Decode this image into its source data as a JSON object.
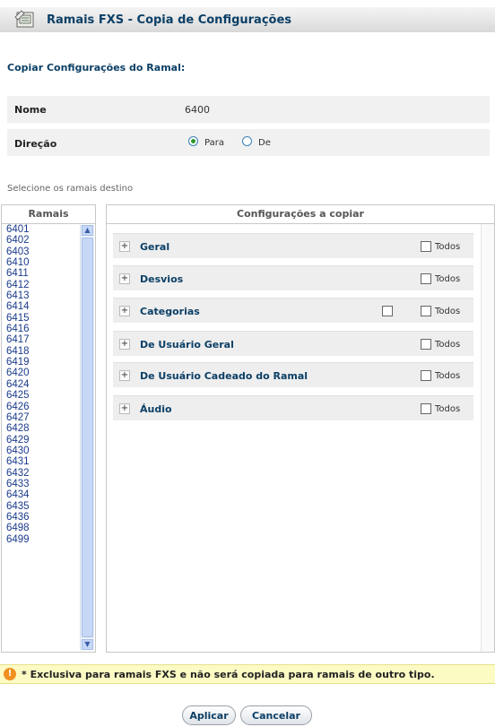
{
  "header": {
    "title": "Ramais FXS - Copia de Configurações",
    "icon": "phone-book-icon"
  },
  "section_title": "Copiar Configurações do Ramal:",
  "form": {
    "nome_label": "Nome",
    "nome_value": "6400",
    "direcao_label": "Direção",
    "radio_para": "Para",
    "radio_de": "De",
    "selected": "Para"
  },
  "hint": "Selecione os ramais destino",
  "ramais": {
    "header": "Ramais",
    "items": [
      "6401",
      "6402",
      "6403",
      "6410",
      "6411",
      "6412",
      "6413",
      "6414",
      "6415",
      "6416",
      "6417",
      "6418",
      "6419",
      "6420",
      "6424",
      "6425",
      "6426",
      "6427",
      "6428",
      "6429",
      "6430",
      "6431",
      "6432",
      "6433",
      "6434",
      "6435",
      "6436",
      "6498",
      "6499"
    ]
  },
  "config": {
    "header": "Configurações a copiar",
    "todos_label": "Todos",
    "rows": [
      {
        "label": "Geral",
        "extra_checkbox": false
      },
      {
        "label": "Desvios",
        "extra_checkbox": false
      },
      {
        "label": "Categorias",
        "extra_checkbox": true
      },
      {
        "label": "De Usuário Geral",
        "extra_checkbox": false
      },
      {
        "label": "De Usuário Cadeado do Ramal",
        "extra_checkbox": false
      },
      {
        "label": "Áudio",
        "extra_checkbox": false
      }
    ]
  },
  "notice": {
    "icon": "warning-icon",
    "text": "* Exclusiva para ramais FXS e não será copiada para ramais de outro tipo."
  },
  "buttons": {
    "apply": "Aplicar",
    "cancel": "Cancelar"
  }
}
